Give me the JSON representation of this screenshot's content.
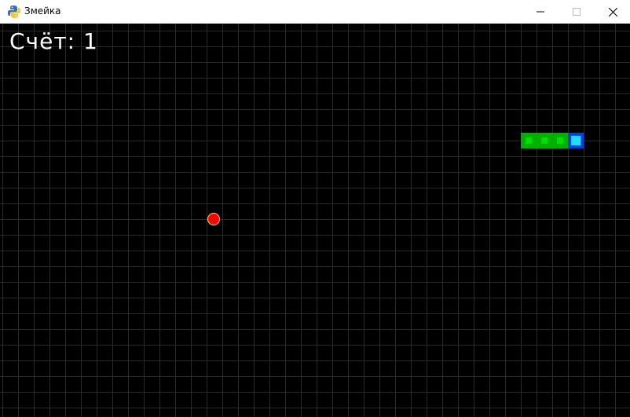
{
  "window": {
    "title": "Змейка",
    "icon": "python-icon",
    "controls": [
      "minimize-icon",
      "maximize-icon",
      "close-icon"
    ]
  },
  "game": {
    "score_text": "Счёт: 1",
    "colors": {
      "background": "#000000",
      "grid": "#2a2a2a",
      "snake_body": "#00c000",
      "snake_head": "#22ddff",
      "food": "#ff0000"
    }
  }
}
